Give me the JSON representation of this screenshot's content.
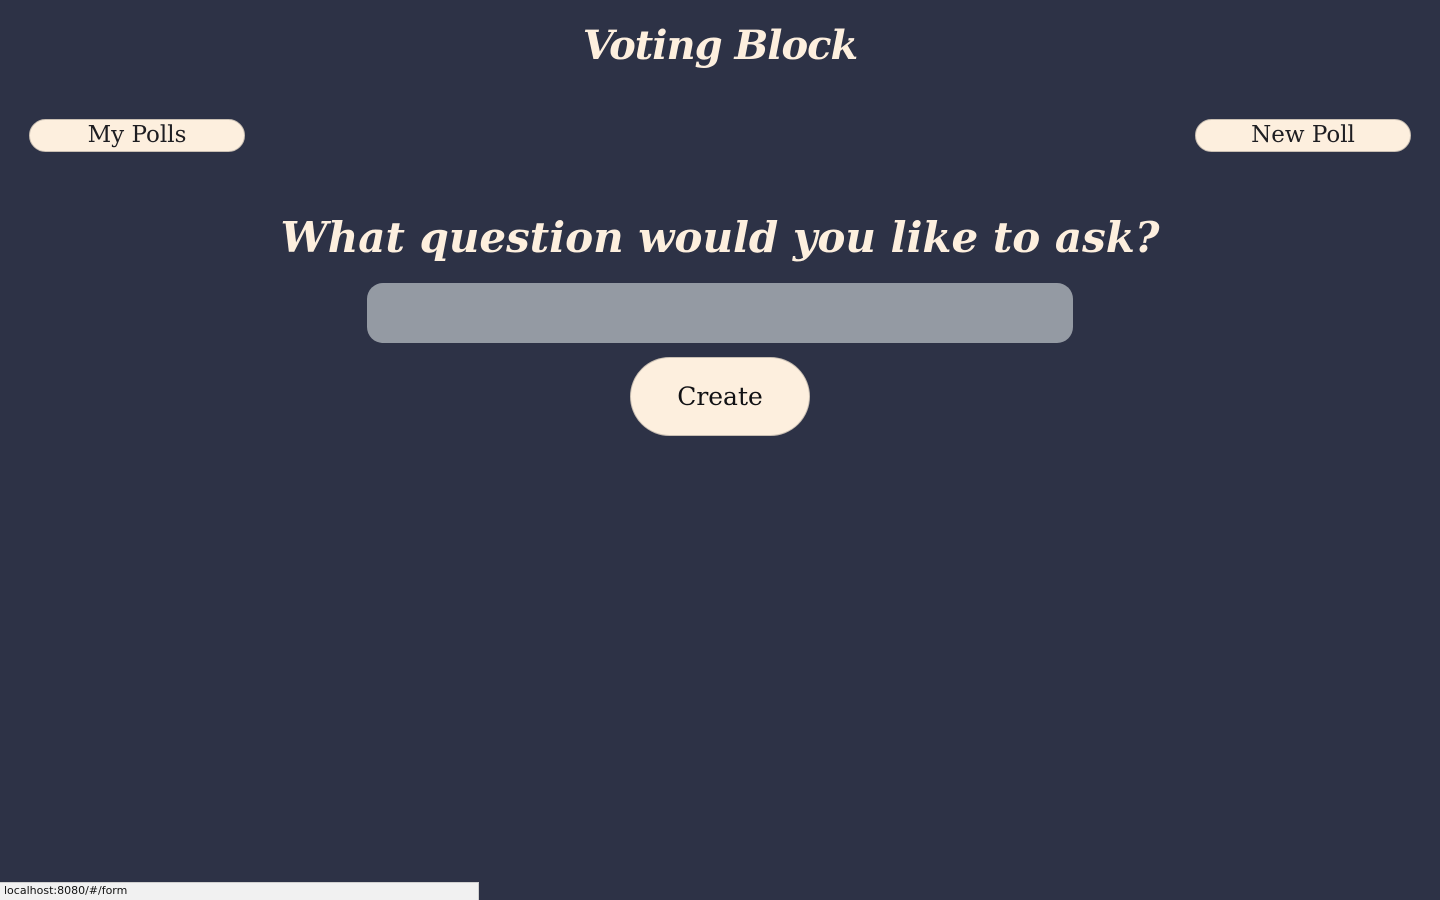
{
  "app": {
    "title": "Voting Block"
  },
  "nav": {
    "my_polls_label": "My Polls",
    "new_poll_label": "New Poll"
  },
  "form": {
    "question_heading": "What question would you like to ask?",
    "question_value": "",
    "question_placeholder": "",
    "create_label": "Create"
  },
  "status_bar": {
    "url": "localhost:8080/#/form"
  },
  "colors": {
    "background": "#2d3246",
    "accent_cream": "#fdefde",
    "input_gray": "#949aa3"
  }
}
